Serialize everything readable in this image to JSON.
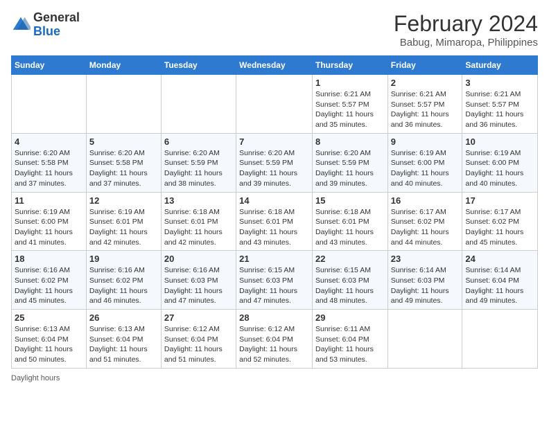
{
  "header": {
    "logo_general": "General",
    "logo_blue": "Blue",
    "title": "February 2024",
    "subtitle": "Babug, Mimaropa, Philippines"
  },
  "calendar": {
    "days_of_week": [
      "Sunday",
      "Monday",
      "Tuesday",
      "Wednesday",
      "Thursday",
      "Friday",
      "Saturday"
    ],
    "weeks": [
      [
        {
          "day": "",
          "info": ""
        },
        {
          "day": "",
          "info": ""
        },
        {
          "day": "",
          "info": ""
        },
        {
          "day": "",
          "info": ""
        },
        {
          "day": "1",
          "info": "Sunrise: 6:21 AM\nSunset: 5:57 PM\nDaylight: 11 hours and 35 minutes."
        },
        {
          "day": "2",
          "info": "Sunrise: 6:21 AM\nSunset: 5:57 PM\nDaylight: 11 hours and 36 minutes."
        },
        {
          "day": "3",
          "info": "Sunrise: 6:21 AM\nSunset: 5:57 PM\nDaylight: 11 hours and 36 minutes."
        }
      ],
      [
        {
          "day": "4",
          "info": "Sunrise: 6:20 AM\nSunset: 5:58 PM\nDaylight: 11 hours and 37 minutes."
        },
        {
          "day": "5",
          "info": "Sunrise: 6:20 AM\nSunset: 5:58 PM\nDaylight: 11 hours and 37 minutes."
        },
        {
          "day": "6",
          "info": "Sunrise: 6:20 AM\nSunset: 5:59 PM\nDaylight: 11 hours and 38 minutes."
        },
        {
          "day": "7",
          "info": "Sunrise: 6:20 AM\nSunset: 5:59 PM\nDaylight: 11 hours and 39 minutes."
        },
        {
          "day": "8",
          "info": "Sunrise: 6:20 AM\nSunset: 5:59 PM\nDaylight: 11 hours and 39 minutes."
        },
        {
          "day": "9",
          "info": "Sunrise: 6:19 AM\nSunset: 6:00 PM\nDaylight: 11 hours and 40 minutes."
        },
        {
          "day": "10",
          "info": "Sunrise: 6:19 AM\nSunset: 6:00 PM\nDaylight: 11 hours and 40 minutes."
        }
      ],
      [
        {
          "day": "11",
          "info": "Sunrise: 6:19 AM\nSunset: 6:00 PM\nDaylight: 11 hours and 41 minutes."
        },
        {
          "day": "12",
          "info": "Sunrise: 6:19 AM\nSunset: 6:01 PM\nDaylight: 11 hours and 42 minutes."
        },
        {
          "day": "13",
          "info": "Sunrise: 6:18 AM\nSunset: 6:01 PM\nDaylight: 11 hours and 42 minutes."
        },
        {
          "day": "14",
          "info": "Sunrise: 6:18 AM\nSunset: 6:01 PM\nDaylight: 11 hours and 43 minutes."
        },
        {
          "day": "15",
          "info": "Sunrise: 6:18 AM\nSunset: 6:01 PM\nDaylight: 11 hours and 43 minutes."
        },
        {
          "day": "16",
          "info": "Sunrise: 6:17 AM\nSunset: 6:02 PM\nDaylight: 11 hours and 44 minutes."
        },
        {
          "day": "17",
          "info": "Sunrise: 6:17 AM\nSunset: 6:02 PM\nDaylight: 11 hours and 45 minutes."
        }
      ],
      [
        {
          "day": "18",
          "info": "Sunrise: 6:16 AM\nSunset: 6:02 PM\nDaylight: 11 hours and 45 minutes."
        },
        {
          "day": "19",
          "info": "Sunrise: 6:16 AM\nSunset: 6:02 PM\nDaylight: 11 hours and 46 minutes."
        },
        {
          "day": "20",
          "info": "Sunrise: 6:16 AM\nSunset: 6:03 PM\nDaylight: 11 hours and 47 minutes."
        },
        {
          "day": "21",
          "info": "Sunrise: 6:15 AM\nSunset: 6:03 PM\nDaylight: 11 hours and 47 minutes."
        },
        {
          "day": "22",
          "info": "Sunrise: 6:15 AM\nSunset: 6:03 PM\nDaylight: 11 hours and 48 minutes."
        },
        {
          "day": "23",
          "info": "Sunrise: 6:14 AM\nSunset: 6:03 PM\nDaylight: 11 hours and 49 minutes."
        },
        {
          "day": "24",
          "info": "Sunrise: 6:14 AM\nSunset: 6:04 PM\nDaylight: 11 hours and 49 minutes."
        }
      ],
      [
        {
          "day": "25",
          "info": "Sunrise: 6:13 AM\nSunset: 6:04 PM\nDaylight: 11 hours and 50 minutes."
        },
        {
          "day": "26",
          "info": "Sunrise: 6:13 AM\nSunset: 6:04 PM\nDaylight: 11 hours and 51 minutes."
        },
        {
          "day": "27",
          "info": "Sunrise: 6:12 AM\nSunset: 6:04 PM\nDaylight: 11 hours and 51 minutes."
        },
        {
          "day": "28",
          "info": "Sunrise: 6:12 AM\nSunset: 6:04 PM\nDaylight: 11 hours and 52 minutes."
        },
        {
          "day": "29",
          "info": "Sunrise: 6:11 AM\nSunset: 6:04 PM\nDaylight: 11 hours and 53 minutes."
        },
        {
          "day": "",
          "info": ""
        },
        {
          "day": "",
          "info": ""
        }
      ]
    ]
  },
  "footer": {
    "daylight_hours": "Daylight hours"
  }
}
